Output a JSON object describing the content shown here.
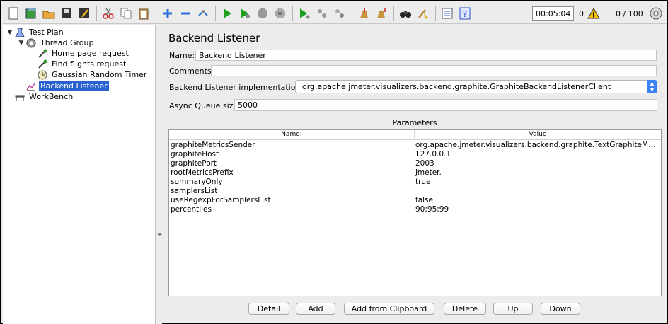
{
  "toolbar": {
    "icons": [
      "new-icon",
      "templates-icon",
      "open-icon",
      "save-icon",
      "save-as-icon",
      "cut-icon",
      "copy-icon",
      "paste-icon",
      "expand-icon",
      "collapse-icon",
      "toggle-icon",
      "start-icon",
      "start-no-pause-icon",
      "stop-icon",
      "shutdown-icon",
      "remote-start-icon",
      "remote-stop-icon",
      "remote-shutdown-icon",
      "clear-icon",
      "clear-all-icon",
      "search-icon",
      "reset-search-icon",
      "function-helper-icon",
      "help-icon"
    ],
    "timer": "00:05:04",
    "error_count": "0",
    "threads": "0 / 100"
  },
  "tree": {
    "nodes": [
      {
        "label": "Test Plan",
        "icon": "test-plan-icon"
      },
      {
        "label": "Thread Group",
        "icon": "thread-group-icon"
      },
      {
        "label": "Home page request",
        "icon": "sampler-icon"
      },
      {
        "label": "Find flights request",
        "icon": "sampler-icon"
      },
      {
        "label": "Gaussian Random Timer",
        "icon": "timer-icon"
      },
      {
        "label": "Backend Listener",
        "icon": "listener-icon"
      },
      {
        "label": "WorkBench",
        "icon": "workbench-icon"
      }
    ]
  },
  "panel": {
    "title": "Backend Listener",
    "name_label": "Name:",
    "name_value": "Backend Listener",
    "comments_label": "Comments:",
    "comments_value": "",
    "impl_label": "Backend Listener implementation",
    "impl_value": "org.apache.jmeter.visualizers.backend.graphite.GraphiteBackendListenerClient",
    "queue_label": "Async Queue size",
    "queue_value": "5000",
    "params_title": "Parameters"
  },
  "table": {
    "headers": [
      "Name:",
      "Value"
    ],
    "rows": [
      [
        "graphiteMetricsSender",
        "org.apache.jmeter.visualizers.backend.graphite.TextGraphiteMetricsS..."
      ],
      [
        "graphiteHost",
        "127.0.0.1"
      ],
      [
        "graphitePort",
        "2003"
      ],
      [
        "rootMetricsPrefix",
        "jmeter."
      ],
      [
        "summaryOnly",
        "true"
      ],
      [
        "samplersList",
        ""
      ],
      [
        "useRegexpForSamplersList",
        "false"
      ],
      [
        "percentiles",
        "90;95;99"
      ]
    ]
  },
  "buttons": {
    "detail": "Detail",
    "add": "Add",
    "add_clipboard": "Add from Clipboard",
    "delete": "Delete",
    "up": "Up",
    "down": "Down"
  },
  "colors": {
    "selection": "#2862d0",
    "play_green": "#1f9e1f",
    "select_arrow": "#3b82f5"
  }
}
